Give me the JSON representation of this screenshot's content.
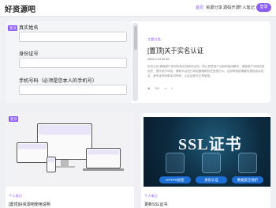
{
  "header": {
    "logo": "好资源吧",
    "nav": [
      "首页",
      "资源分享",
      "源码开源",
      "个人笔记"
    ],
    "login": "登录"
  },
  "form_card": {
    "tag": "置顶",
    "fields": [
      {
        "label": "真实姓名",
        "value": ""
      },
      {
        "label": "身份证号",
        "value": ""
      },
      {
        "label": "手机号码（必须是您本人的手机号）",
        "value": ""
      }
    ]
  },
  "featured": {
    "category": "主要分类",
    "title": "[置顶]关于实名认证",
    "date": "2025.4.24 20:46",
    "description": "实名认证 确保用户身份的真实性和安全性，防止恶意用户注册和滥用服务。增强用户对网站的信任，提升用户体验。帮助平台进行风险管理和防范违规行为，注册审核前需要你提供真实姓名、身份证号码和手机号码，认证后即可正常使用。",
    "views": "336",
    "comments": "1"
  },
  "cards": [
    {
      "tag": "置顶",
      "category": "个人笔记",
      "title": "[置顶]好资源吧使用说明"
    },
    {
      "category": "个人笔记",
      "title": "更新SSL证书",
      "image_text": "SSL证书",
      "pills": [
        "HTTPS加密",
        "身份认证",
        "数据安全保护"
      ]
    }
  ],
  "colors": {
    "accent": "#8b5cf6",
    "ssl_bg": "#0d2b40",
    "pill": "#1d6fd6"
  }
}
